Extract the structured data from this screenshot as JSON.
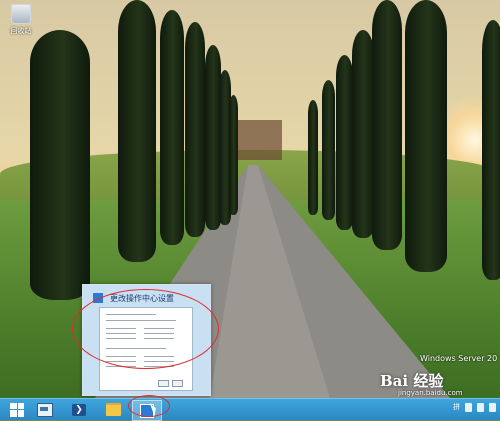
{
  "desktop": {
    "recycle_bin_label": "回收站",
    "os_watermark": "Windows Server 20",
    "baidu_watermark": "Bai 经验",
    "baidu_url": "jingyan.baidu.com"
  },
  "thumbnail": {
    "title": "更改操作中心设置"
  },
  "taskbar": {
    "items": [
      {
        "name": "start",
        "icon": "windows-icon"
      },
      {
        "name": "server-manager",
        "icon": "server-manager-icon"
      },
      {
        "name": "powershell",
        "icon": "powershell-icon",
        "glyph": "❯"
      },
      {
        "name": "file-explorer",
        "icon": "folder-icon"
      },
      {
        "name": "action-center",
        "icon": "action-center-flag-icon"
      }
    ],
    "tray_lang": "拼"
  },
  "annotation_color": "#e22a2a",
  "taskbar_color": "#2b88c4"
}
